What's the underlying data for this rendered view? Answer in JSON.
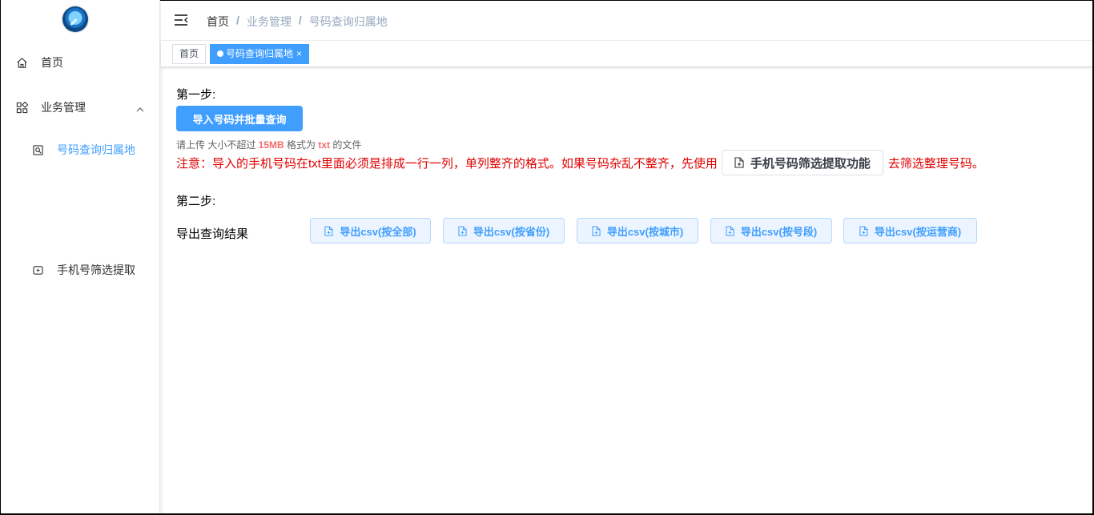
{
  "sidebar": {
    "items": [
      {
        "label": "首页",
        "icon": "home-icon"
      },
      {
        "label": "业务管理",
        "icon": "apps-icon"
      },
      {
        "label": "号码查询归属地",
        "icon": "search-doc-icon"
      },
      {
        "label": "手机号筛选提取",
        "icon": "filter-icon"
      }
    ]
  },
  "header": {
    "breadcrumb": [
      "首页",
      "业务管理",
      "号码查询归属地"
    ],
    "separator": "/"
  },
  "tags": [
    {
      "label": "首页"
    },
    {
      "label": "号码查询归属地",
      "close": "×"
    }
  ],
  "main": {
    "step1_label": "第一步:",
    "import_button": "导入号码并批量查询",
    "tip": {
      "prefix": "请上传 大小不超过 ",
      "size": "15MB",
      "mid": " 格式为 ",
      "format": "txt",
      "suffix": " 的文件"
    },
    "notice": {
      "before": "注意：导入的手机号码在txt里面必须是排成一行一列，单列整齐的格式。如果号码杂乱不整齐，先使用",
      "button": "手机号码筛选提取功能",
      "after": "去筛选整理号码。"
    },
    "step2_label": "第二步:",
    "export_label": "导出查询结果",
    "export_buttons": [
      "导出csv(按全部)",
      "导出csv(按省份)",
      "导出csv(按城市)",
      "导出csv(按号段)",
      "导出csv(按运营商)"
    ]
  },
  "colors": {
    "primary": "#409eff",
    "danger_text": "#e00000",
    "highlight": "#f56c6c"
  }
}
